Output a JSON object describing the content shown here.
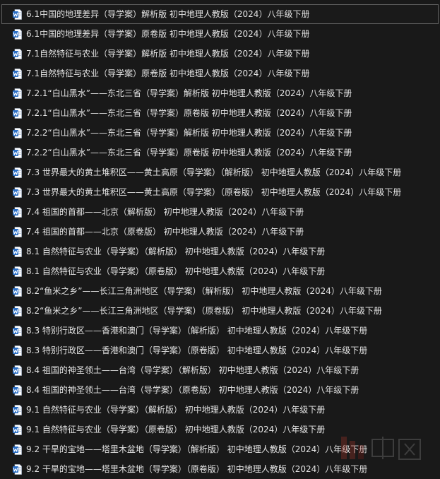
{
  "icon": "word-document-icon",
  "colors": {
    "background": "#191919",
    "text": "#e3e3e3",
    "word_blue": "#2b6fc6",
    "selection_border": "#5f5f5f",
    "watermark_red": "#c0392b"
  },
  "files": [
    {
      "name": "6.1中国的地理差异（导学案）解析版   初中地理人教版（2024）八年级下册",
      "selected": true
    },
    {
      "name": "6.1中国的地理差异（导学案）原卷版   初中地理人教版（2024）八年级下册"
    },
    {
      "name": "7.1自然特征与农业（导学案）解析版   初中地理人教版（2024）八年级下册"
    },
    {
      "name": "7.1自然特征与农业（导学案）原卷版   初中地理人教版（2024）八年级下册"
    },
    {
      "name": "7.2.1“白山黑水”——东北三省（导学案）解析版   初中地理人教版（2024）八年级下册"
    },
    {
      "name": "7.2.1“白山黑水”——东北三省（导学案）原卷版   初中地理人教版（2024）八年级下册"
    },
    {
      "name": "7.2.2“白山黑水”——东北三省（导学案）解析版   初中地理人教版（2024）八年级下册"
    },
    {
      "name": "7.2.2“白山黑水”——东北三省（导学案）原卷版   初中地理人教版（2024）八年级下册"
    },
    {
      "name": "7.3 世界最大的黄土堆积区——黄土高原（导学案）（解析版）  初中地理人教版（2024）八年级下册"
    },
    {
      "name": "7.3 世界最大的黄土堆积区——黄土高原（导学案）（原卷版）  初中地理人教版（2024）八年级下册"
    },
    {
      "name": "7.4 祖国的首都——北京（解析版）  初中地理人教版（2024）八年级下册"
    },
    {
      "name": "7.4 祖国的首都——北京（原卷版）  初中地理人教版（2024）八年级下册"
    },
    {
      "name": "8.1 自然特征与农业（导学案）（解析版）  初中地理人教版（2024）八年级下册"
    },
    {
      "name": "8.1 自然特征与农业（导学案）（原卷版）  初中地理人教版（2024）八年级下册"
    },
    {
      "name": "8.2“鱼米之乡”——长江三角洲地区（导学案）（解析版）  初中地理人教版（2024）八年级下册"
    },
    {
      "name": "8.2“鱼米之乡”——长江三角洲地区（导学案）（原卷版）  初中地理人教版（2024）八年级下册"
    },
    {
      "name": "8.3 特别行政区——香港和澳门（导学案）（解析版）  初中地理人教版（2024）八年级下册"
    },
    {
      "name": "8.3 特别行政区——香港和澳门（导学案）（原卷版）  初中地理人教版（2024）八年级下册"
    },
    {
      "name": "8.4 祖国的神圣领土——台湾（导学案）（解析版）  初中地理人教版（2024）八年级下册"
    },
    {
      "name": "8.4 祖国的神圣领土——台湾（导学案）（原卷版）  初中地理人教版（2024）八年级下册"
    },
    {
      "name": "9.1 自然特征与农业（导学案）（解析版）  初中地理人教版（2024）八年级下册"
    },
    {
      "name": "9.1 自然特征与农业（导学案）（原卷版）  初中地理人教版（2024）八年级下册"
    },
    {
      "name": "9.2 干旱的宝地——塔里木盆地（导学案）（解析版）  初中地理人教版（2024）八年级下册"
    },
    {
      "name": "9.2 干旱的宝地——塔里木盆地（导学案）（原卷版）  初中地理人教版（2024）八年级下册"
    }
  ]
}
